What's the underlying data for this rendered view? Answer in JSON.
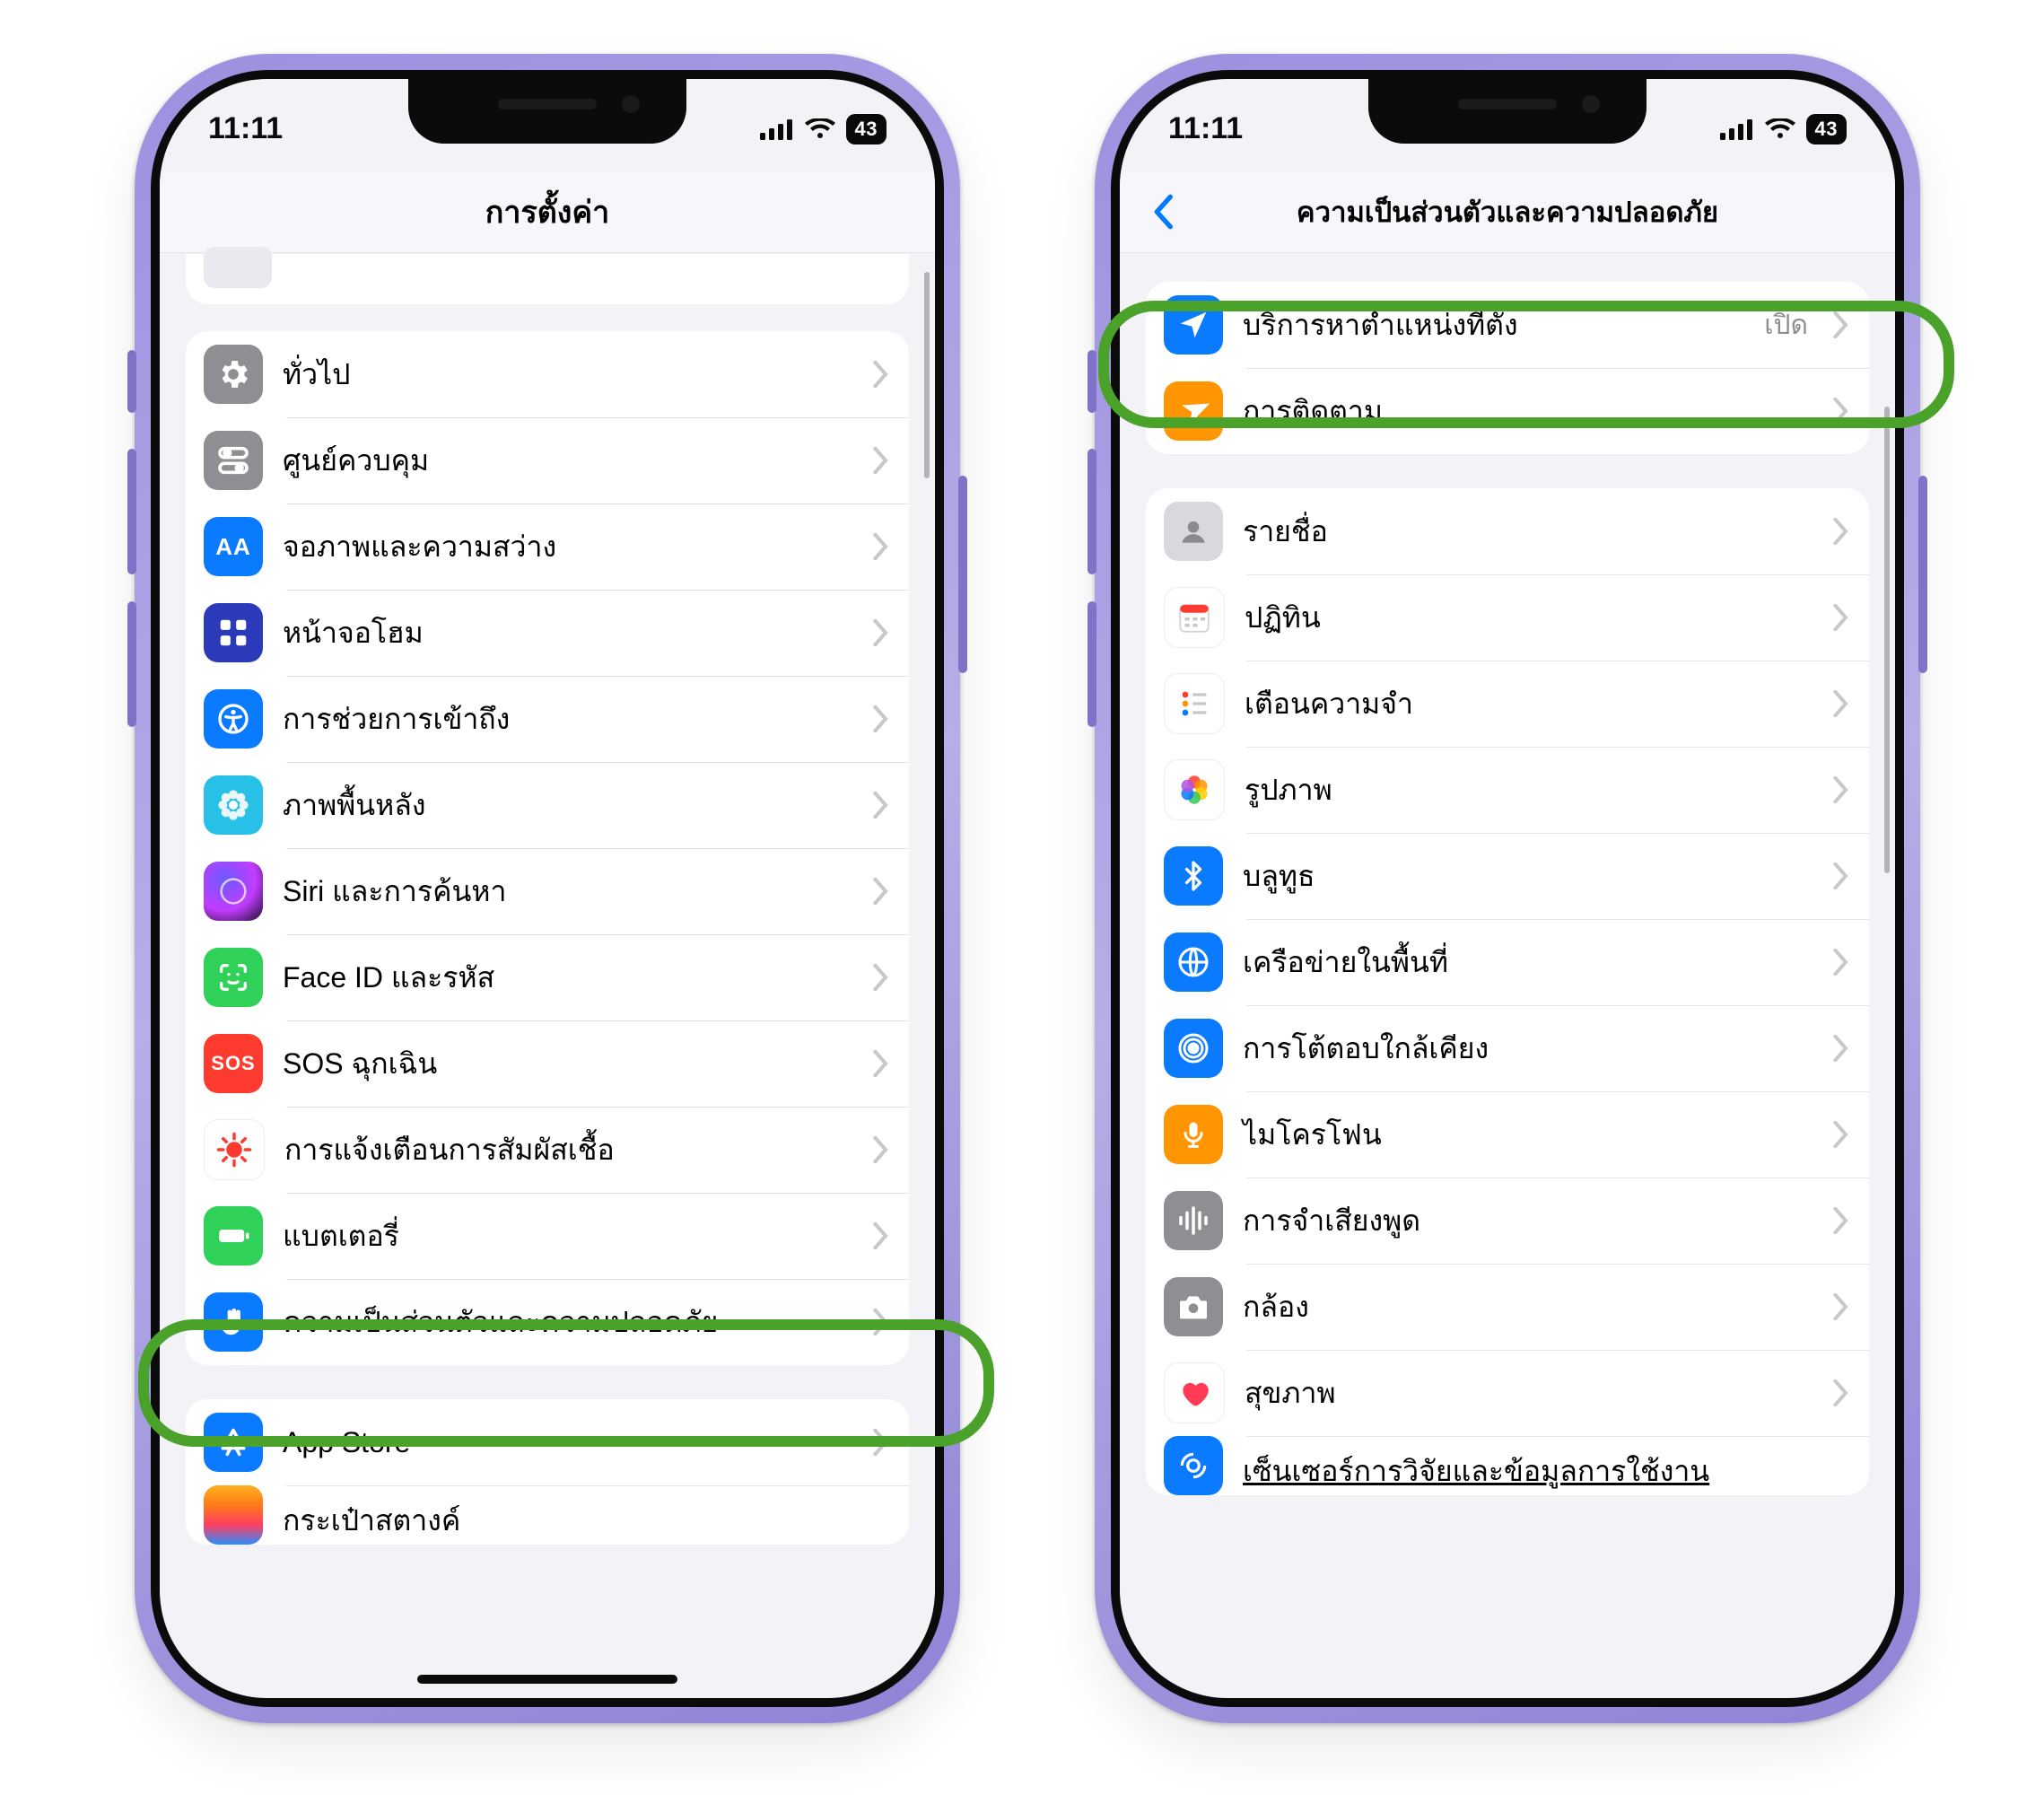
{
  "status": {
    "time": "11:11",
    "battery": "43"
  },
  "left": {
    "title": "การตั้งค่า",
    "rows": [
      {
        "id": "general",
        "label": "ทั่วไป"
      },
      {
        "id": "control-center",
        "label": "ศูนย์ควบคุม"
      },
      {
        "id": "display",
        "label": "จอภาพและความสว่าง"
      },
      {
        "id": "home-screen",
        "label": "หน้าจอโฮม"
      },
      {
        "id": "accessibility",
        "label": "การช่วยการเข้าถึง"
      },
      {
        "id": "wallpaper",
        "label": "ภาพพื้นหลัง"
      },
      {
        "id": "siri",
        "label": "Siri และการค้นหา"
      },
      {
        "id": "faceid",
        "label": "Face ID และรหัส"
      },
      {
        "id": "sos",
        "label": "SOS ฉุกเฉิน",
        "sosText": "SOS"
      },
      {
        "id": "exposure",
        "label": "การแจ้งเตือนการสัมผัสเชื้อ"
      },
      {
        "id": "battery",
        "label": "แบตเตอรี่"
      },
      {
        "id": "privacy",
        "label": "ความเป็นส่วนตัวและความปลอดภัย"
      }
    ],
    "section2": [
      {
        "id": "app-store",
        "label": "App Store"
      },
      {
        "id": "wallet",
        "label": "กระเป๋าสตางค์"
      }
    ]
  },
  "right": {
    "title": "ความเป็นส่วนตัวและความปลอดภัย",
    "group1": [
      {
        "id": "location",
        "label": "บริการหาตำแหน่งที่ตั้ง",
        "value": "เปิด"
      },
      {
        "id": "tracking",
        "label": "การติดตาม"
      }
    ],
    "group2": [
      {
        "id": "contacts",
        "label": "รายชื่อ"
      },
      {
        "id": "calendar",
        "label": "ปฏิทิน"
      },
      {
        "id": "reminders",
        "label": "เตือนความจำ"
      },
      {
        "id": "photos",
        "label": "รูปภาพ"
      },
      {
        "id": "bluetooth",
        "label": "บลูทูธ"
      },
      {
        "id": "local-network",
        "label": "เครือข่ายในพื้นที่"
      },
      {
        "id": "nearby",
        "label": "การโต้ตอบใกล้เคียง"
      },
      {
        "id": "microphone",
        "label": "ไมโครโฟน"
      },
      {
        "id": "speech",
        "label": "การจำเสียงพูด"
      },
      {
        "id": "camera",
        "label": "กล้อง"
      },
      {
        "id": "health",
        "label": "สุขภาพ"
      },
      {
        "id": "research",
        "label": "เซ็นเซอร์การวิจัยและข้อมูลการใช้งาน"
      }
    ]
  }
}
